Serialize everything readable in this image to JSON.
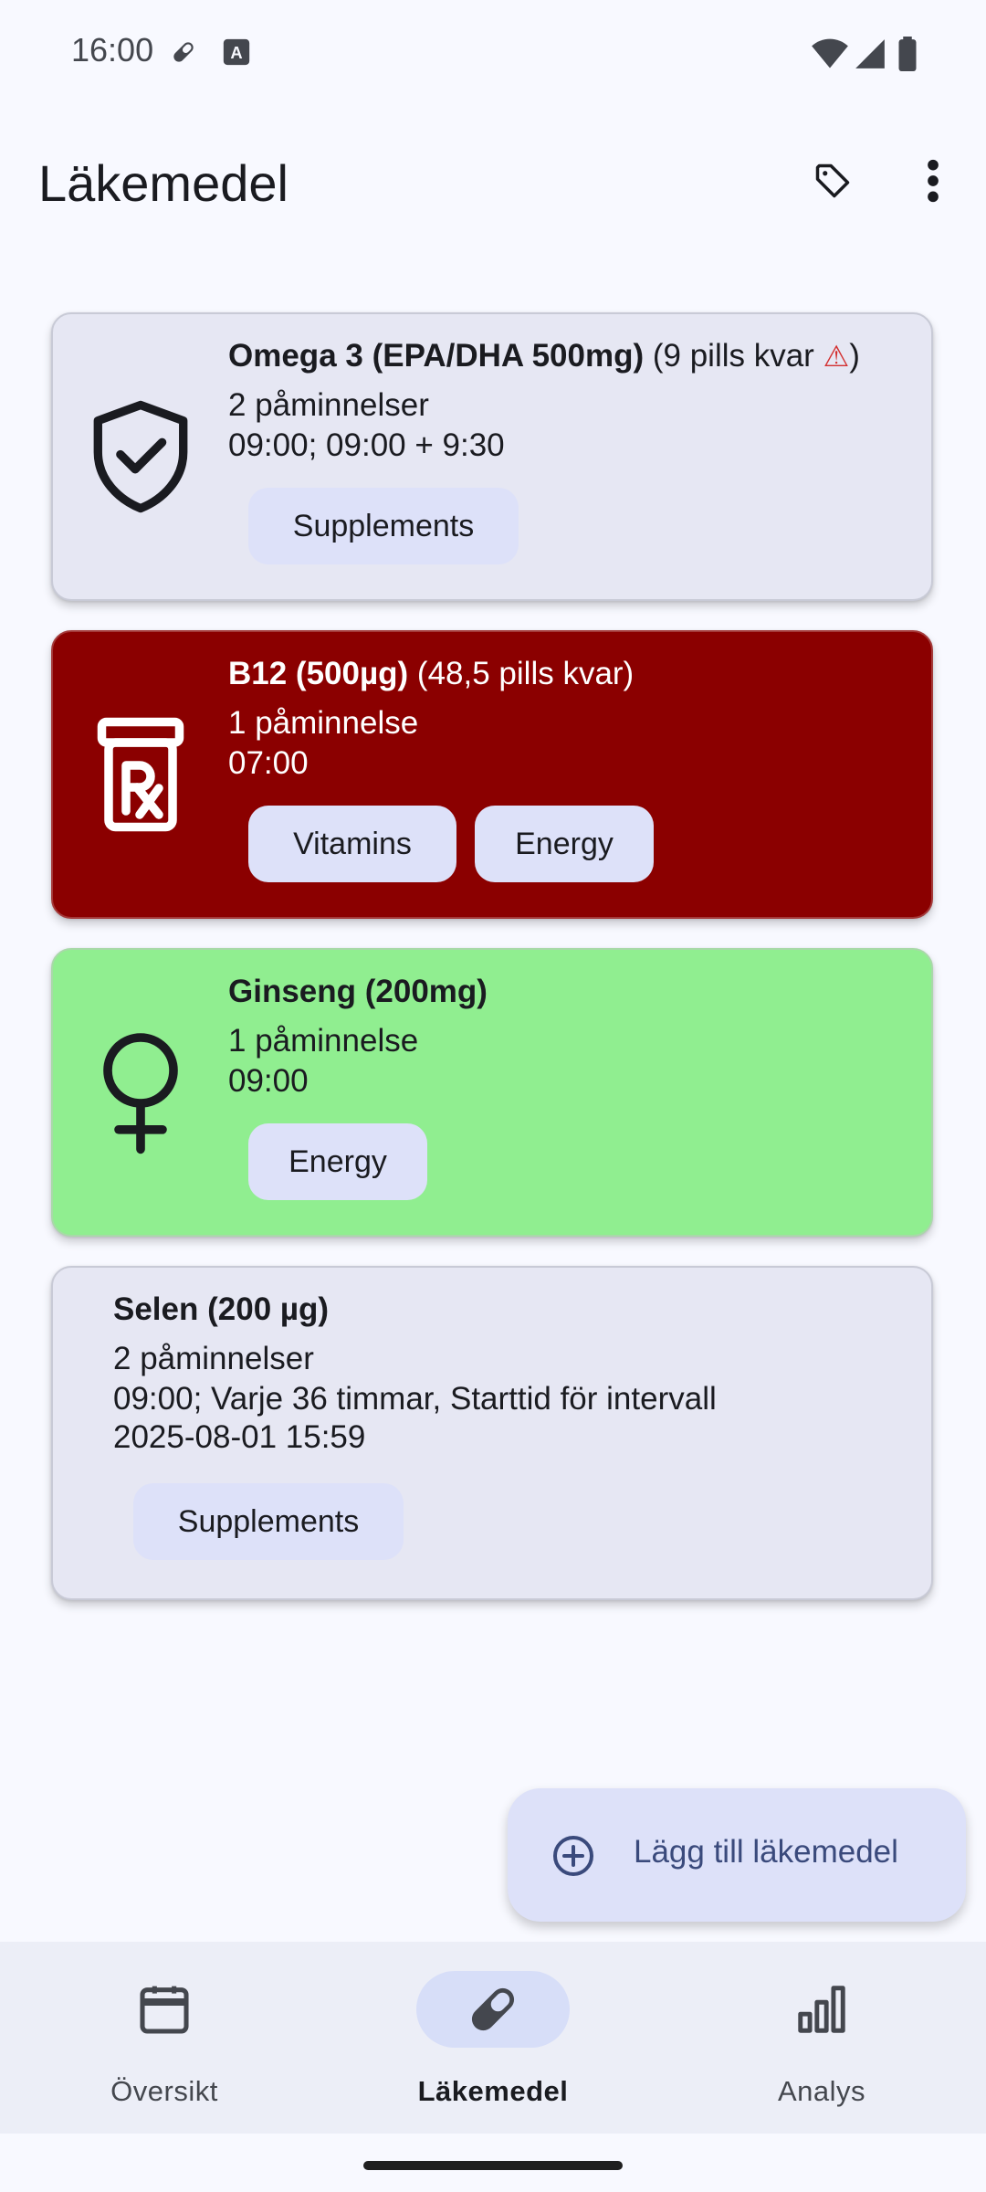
{
  "status_bar": {
    "time": "16:00"
  },
  "app_bar": {
    "title": "Läkemedel"
  },
  "medications": [
    {
      "name": "Omega 3 (EPA/DHA 500mg)",
      "stock_prefix": "(9 pills kvar ",
      "stock_suffix": ")",
      "warning_glyph": "⚠",
      "reminders": "2 påminnelser",
      "schedule": "09:00; 09:00 + 9:30",
      "tags": [
        "Supplements"
      ],
      "icon": "shield-check-icon",
      "color": "#e6e7f3"
    },
    {
      "name": "B12 (500µg)",
      "stock": "(48,5 pills kvar)",
      "reminders": "1 påminnelse",
      "schedule": "07:00",
      "tags": [
        "Vitamins",
        "Energy"
      ],
      "icon": "prescription-bottle-icon",
      "color": "#8b0000"
    },
    {
      "name": "Ginseng (200mg)",
      "reminders": "1 påminnelse",
      "schedule": "09:00",
      "tags": [
        "Energy"
      ],
      "icon": "female-symbol-icon",
      "color": "#90ee90"
    },
    {
      "name": "Selen (200 µg)",
      "reminders": "2 påminnelser",
      "schedule_line1": "09:00; Varje 36 timmar, Starttid för intervall",
      "schedule_line2": "2025-08-01 15:59",
      "tags": [
        "Supplements"
      ],
      "color": "#e6e7f3"
    }
  ],
  "fab": {
    "label": "Lägg till läkemedel",
    "icon": "add-circle-icon"
  },
  "bottom_nav": [
    {
      "label": "Översikt",
      "icon": "calendar-icon",
      "selected": false
    },
    {
      "label": "Läkemedel",
      "icon": "pill-icon",
      "selected": true
    },
    {
      "label": "Analys",
      "icon": "bar-chart-icon",
      "selected": false
    }
  ],
  "colors": {
    "background": "#f8f9ff",
    "chip": "#dde1f9",
    "nav_pill": "#d7def8",
    "warning": "#d32f2f"
  }
}
